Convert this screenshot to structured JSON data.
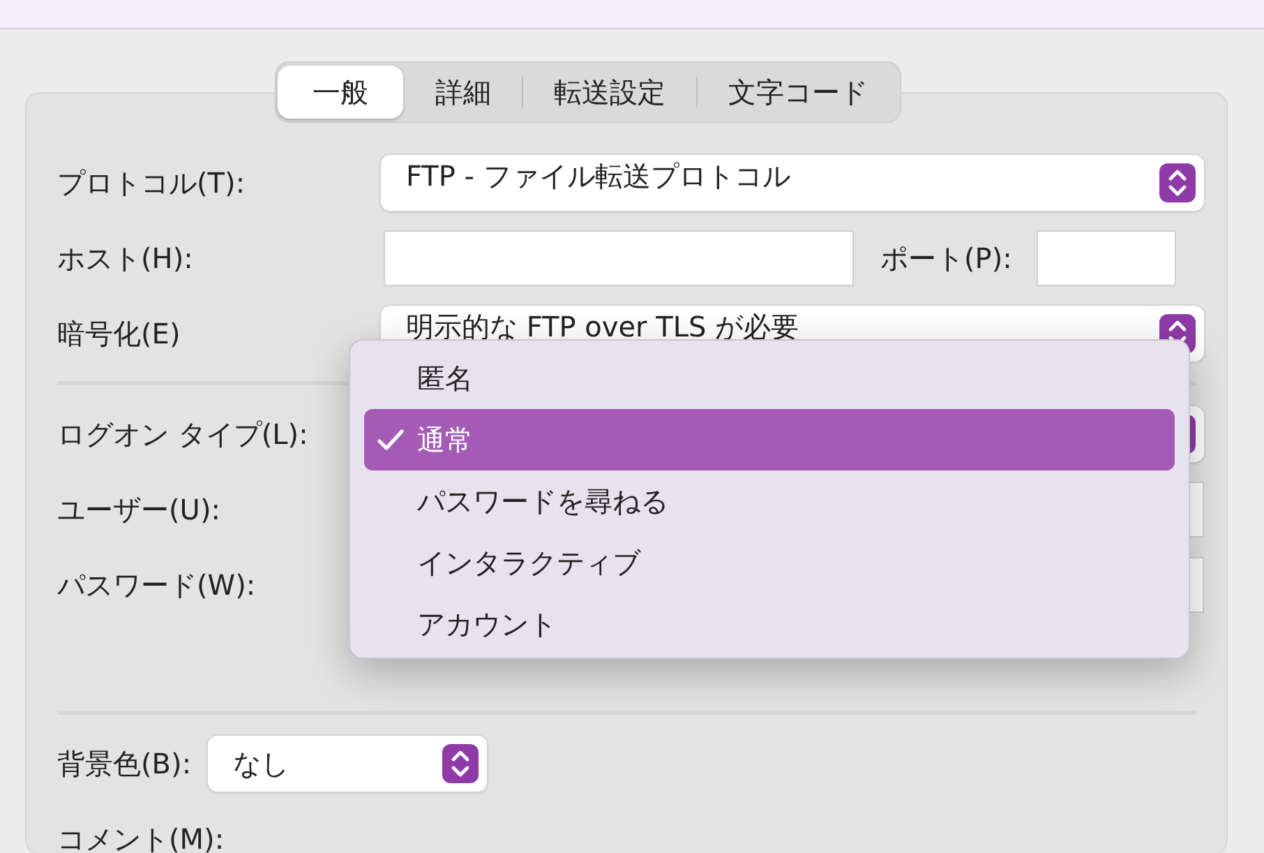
{
  "tabs": [
    {
      "label": "一般",
      "selected": true
    },
    {
      "label": "詳細",
      "selected": false
    },
    {
      "label": "転送設定",
      "selected": false
    },
    {
      "label": "文字コード",
      "selected": false
    }
  ],
  "form": [
    {
      "kind": "select",
      "label": "プロトコル(T):",
      "value": "FTP - ファイル転送プロトコル"
    },
    {
      "kind": "host",
      "label": "ホスト(H):",
      "port_label": "ポート(P):"
    },
    {
      "kind": "select",
      "label": "暗号化(E)",
      "value": "明示的な FTP over TLS が必要"
    },
    {
      "kind": "divider"
    },
    {
      "kind": "select",
      "label": "ログオン タイプ(L):"
    },
    {
      "kind": "input",
      "label": "ユーザー(U):"
    },
    {
      "kind": "input",
      "label": "パスワード(W):"
    },
    {
      "kind": "spacer"
    },
    {
      "kind": "divider"
    },
    {
      "kind": "small-select",
      "label": "背景色(B):",
      "value": "なし"
    },
    {
      "kind": "label",
      "label": "コメント(M):"
    }
  ],
  "popup_menu": {
    "items": [
      {
        "label": "匿名",
        "selected": false
      },
      {
        "label": "通常",
        "selected": true
      },
      {
        "label": "パスワードを尋ねる",
        "selected": false
      },
      {
        "label": "インタラクティブ",
        "selected": false
      },
      {
        "label": "アカウント",
        "selected": false
      }
    ]
  }
}
